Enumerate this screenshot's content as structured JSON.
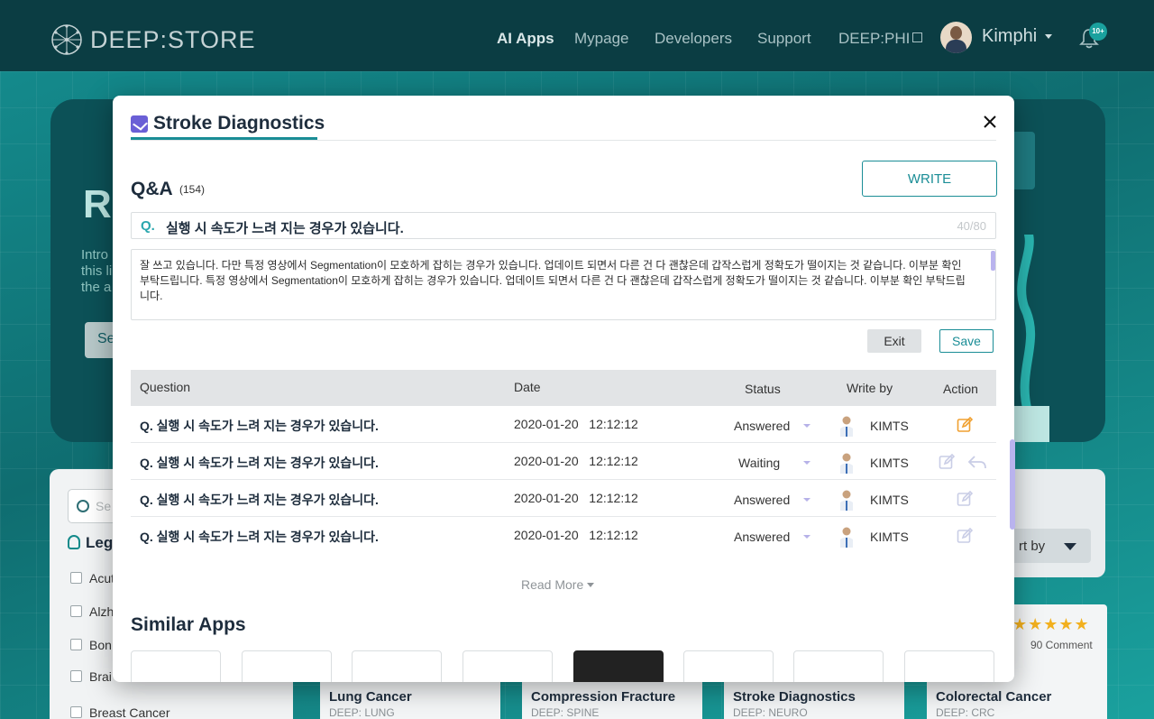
{
  "header": {
    "logo_text": "DEEP:STORE",
    "nav": [
      {
        "label": "AI Apps",
        "active": true
      },
      {
        "label": "Mypage",
        "active": false
      },
      {
        "label": "Developers",
        "active": false
      },
      {
        "label": "Support",
        "active": false
      },
      {
        "label": "DEEP:PHI",
        "active": false,
        "external": true
      }
    ],
    "user_name": "Kimphi",
    "notification_badge": "10+",
    "icons": {
      "logo": "network-logo-icon",
      "avatar": "user-avatar",
      "bell": "bell-icon",
      "external": "external-link-icon"
    }
  },
  "background": {
    "hero_title": "Re",
    "hero_text": [
      "Intro",
      "this li",
      "the a"
    ],
    "hero_button": "Se",
    "search_placeholder": "Se",
    "filter_title": "Leg",
    "filter_items": [
      "Acut",
      "Alzh",
      "Bon",
      "Brai",
      "Breast Cancer"
    ],
    "sort_label": "rt by",
    "cards": [
      {
        "name": "Lung Cancer",
        "sub": "DEEP: LUNG"
      },
      {
        "name": "Compression Fracture",
        "sub": "DEEP: SPINE"
      },
      {
        "name": "Stroke Diagnostics",
        "sub": "DEEP: NEURO"
      },
      {
        "name": "Colorectal Cancer",
        "sub": "DEEP: CRC",
        "stars": "★★★★★",
        "comments": "90 Comment"
      }
    ]
  },
  "modal": {
    "title": "Stroke Diagnostics",
    "close_icon": "close-icon",
    "qa": {
      "heading": "Q&A",
      "count": "(154)",
      "write_label": "WRITE",
      "question_prefix": "Q.",
      "question_value": "실행 시 속도가 느려 지는 경우가 있습니다.",
      "question_counter": "40/80",
      "answer_value": "잘 쓰고 있습니다. 다만 특정 영상에서 Segmentation이 모호하게 잡히는 경우가 있습니다. 업데이트 되면서 다른 건 다 괜찮은데 갑작스럽게 정확도가 떨이지는 것 같습니다. 이부분 확인 부탁드립니다. 특정 영상에서 Segmentation이 모호하게 잡히는 경우가 있습니다. 업데이트 되면서 다른 건 다 괜찮은데 갑작스럽게 정확도가 떨이지는 것 같습니다. 이부분 확인 부탁드립니다.",
      "exit_label": "Exit",
      "save_label": "Save"
    },
    "table": {
      "columns": {
        "question": "Question",
        "date": "Date",
        "status": "Status",
        "writer": "Write by",
        "action": "Action"
      },
      "rows": [
        {
          "question": "Q. 실행 시 속도가 느려 지는 경우가 있습니다.",
          "date": "2020-01-20   12:12:12",
          "status": "Answered",
          "writer": "KIMTS",
          "edit_active": true,
          "reply": false
        },
        {
          "question": "Q. 실행 시 속도가 느려 지는 경우가 있습니다.",
          "date": "2020-01-20   12:12:12",
          "status": "Waiting",
          "writer": "KIMTS",
          "edit_active": false,
          "reply": true
        },
        {
          "question": "Q. 실행 시 속도가 느려 지는 경우가 있습니다.",
          "date": "2020-01-20   12:12:12",
          "status": "Answered",
          "writer": "KIMTS",
          "edit_active": false,
          "reply": false
        },
        {
          "question": "Q. 실행 시 속도가 느려 지는 경우가 있습니다.",
          "date": "2020-01-20   12:12:12",
          "status": "Answered",
          "writer": "KIMTS",
          "edit_active": false,
          "reply": false
        }
      ]
    },
    "read_more": "Read More",
    "similar_heading": "Similar Apps"
  },
  "colors": {
    "accent": "#1a8d96",
    "edit_active": "#f0a030",
    "modal_icon": "#6a5fd6",
    "header_bg": "#0b3d43"
  }
}
